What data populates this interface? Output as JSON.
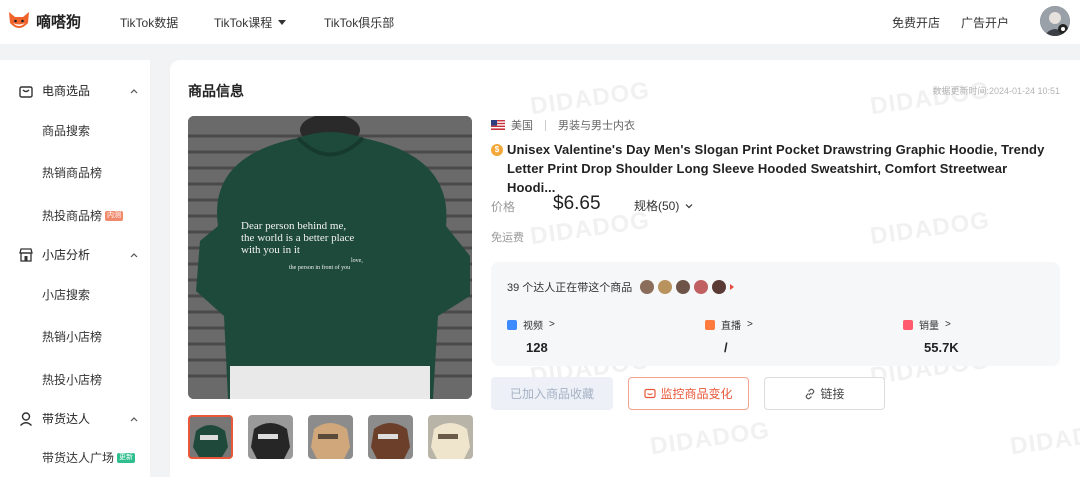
{
  "brand": {
    "name": "嘀嗒狗",
    "logo_icon": "fox-logo-icon"
  },
  "nav": [
    {
      "label": "TikTok数据"
    },
    {
      "label": "TikTok课程",
      "dropdown": true
    },
    {
      "label": "TikTok俱乐部"
    }
  ],
  "topbar_right": {
    "open_store": "免费开店",
    "ad_account": "广告开户"
  },
  "sidebar": {
    "groups": [
      {
        "label": "电商选品",
        "icon": "shopping-bag-icon",
        "expanded": true,
        "items": [
          {
            "label": "商品搜索"
          },
          {
            "label": "热销商品榜"
          },
          {
            "label": "热投商品榜",
            "tag": "内测"
          }
        ]
      },
      {
        "label": "小店分析",
        "icon": "store-icon",
        "expanded": true,
        "items": [
          {
            "label": "小店搜索"
          },
          {
            "label": "热销小店榜"
          },
          {
            "label": "热投小店榜"
          }
        ]
      },
      {
        "label": "带货达人",
        "icon": "person-icon",
        "expanded": true,
        "items": [
          {
            "label": "带货达人广场",
            "tag": "更新"
          }
        ]
      }
    ]
  },
  "product": {
    "section_title": "商品信息",
    "update_time": "数据更新时间:2024-01-24 10:51",
    "watermark": "DIDADOG",
    "country": "美国",
    "category": "男装与男士内衣",
    "title": "Unisex Valentine's Day Men's Slogan Print Pocket Drawstring Graphic Hoodie, Trendy Letter Print Drop Shoulder Long Sleeve Hooded Sweatshirt, Comfort Streetwear Hoodi...",
    "price_label": "价格",
    "price": "$6.65",
    "spec_label": "规格(50)",
    "shipping": "免运费",
    "image_print": {
      "line1": "Dear person behind me,",
      "line2": "the world is a better place",
      "line3": "with you in it",
      "line4": "love,",
      "line5": "the person in front of you"
    },
    "thumbnails": [
      {
        "color": "#1f4a3b",
        "selected": true
      },
      {
        "color": "#2b2b2b",
        "selected": false
      },
      {
        "color": "#c8a47a",
        "selected": false
      },
      {
        "color": "#6b3f2a",
        "selected": false
      },
      {
        "color": "#e8dcc4",
        "selected": false
      }
    ]
  },
  "creators": {
    "text": "39 个达人正在带这个商品",
    "avatars": [
      "#8a6d5a",
      "#b9935d",
      "#6e5448",
      "#c06060",
      "#5a3a34"
    ]
  },
  "stats": [
    {
      "label": "视频",
      "value": "128",
      "icon_color": "#3d8bff"
    },
    {
      "label": "直播",
      "value": "/",
      "icon_color": "#ff7a3d"
    },
    {
      "label": "销量",
      "value": "55.7K",
      "icon_color": "#ff5a6e"
    }
  ],
  "buttons": {
    "added": "已加入商品收藏",
    "monitor": "监控商品变化",
    "link": "链接"
  },
  "colors": {
    "accent": "#e8573a",
    "muted_button": "#edf1f7"
  }
}
